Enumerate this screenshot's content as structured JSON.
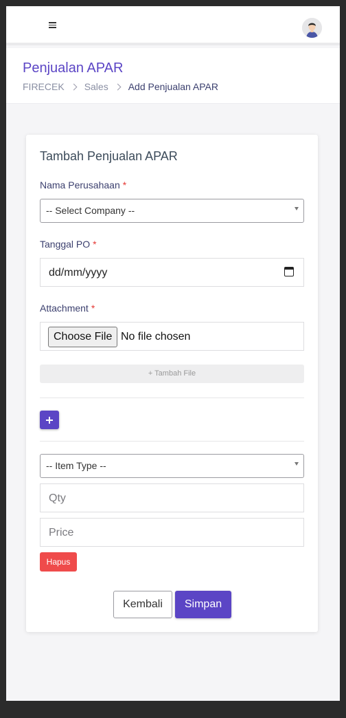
{
  "topbar": {
    "menu_icon": "hamburger-menu-icon",
    "avatar_icon": "user-avatar-icon"
  },
  "header": {
    "title": "Penjualan APAR",
    "breadcrumb": [
      "FIRECEK",
      "Sales",
      "Add Penjualan APAR"
    ]
  },
  "form": {
    "title": "Tambah Penjualan APAR",
    "company_label": "Nama Perusahaan",
    "required_mark": "*",
    "company_select": "-- Select Company --",
    "po_date_label": "Tanggal PO",
    "po_date_placeholder": "dd/mm/yyyy",
    "attachment_label": "Attachment",
    "choose_file": "Choose File",
    "no_file": "No file chosen",
    "add_file": "+ Tambah File",
    "item_type_select": "-- Item Type --",
    "qty_placeholder": "Qty",
    "price_placeholder": "Price",
    "delete_button": "Hapus",
    "back_button": "Kembali",
    "save_button": "Simpan"
  },
  "colors": {
    "primary": "#5b45c5",
    "danger": "#ef4b4b",
    "required": "#e53935"
  }
}
